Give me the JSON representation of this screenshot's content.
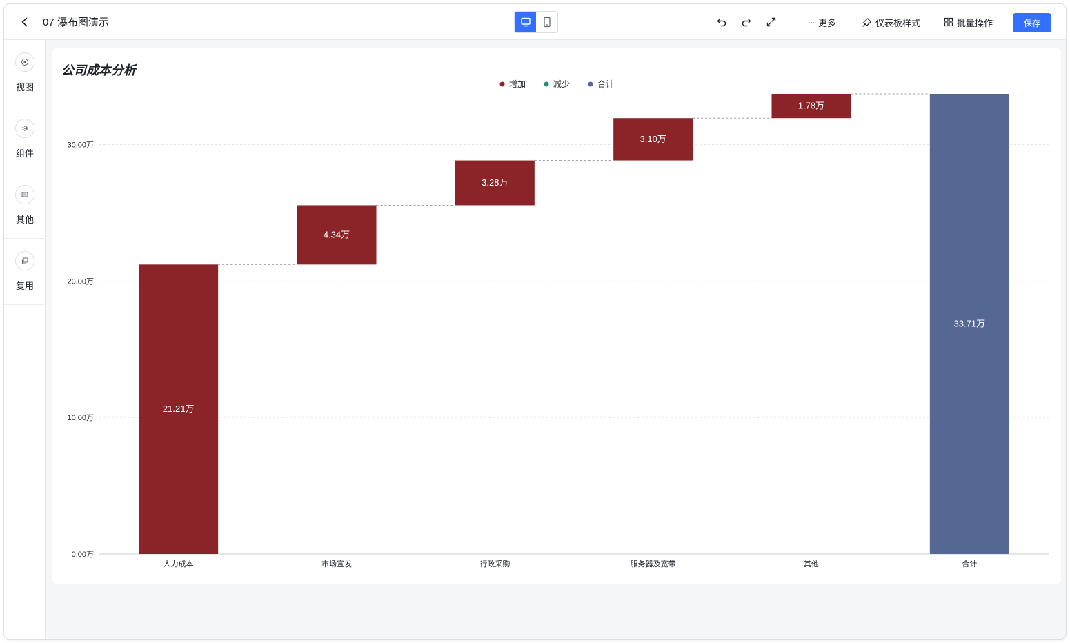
{
  "header": {
    "title": "07 瀑布图演示",
    "more_label": "更多",
    "style_label": "仪表板样式",
    "batch_label": "批量操作",
    "save_label": "保存"
  },
  "sidebar": {
    "items": [
      {
        "label": "视图",
        "icon": "view-icon"
      },
      {
        "label": "组件",
        "icon": "component-icon"
      },
      {
        "label": "其他",
        "icon": "other-icon"
      },
      {
        "label": "复用",
        "icon": "reuse-icon"
      }
    ]
  },
  "colors": {
    "accent": "#3370ff",
    "increase": "#8b2428",
    "decrease": "#2a8a7b",
    "total": "#556893"
  },
  "chart_data": {
    "type": "bar",
    "subtype": "waterfall",
    "title": "公司成本分析",
    "legend": [
      "增加",
      "减少",
      "合计"
    ],
    "legend_position": "top-center",
    "categories": [
      "人力成本",
      "市场宣发",
      "行政采购",
      "服务器及宽带",
      "其他",
      "合计"
    ],
    "values": [
      21.21,
      4.34,
      3.28,
      3.1,
      1.78,
      33.71
    ],
    "value_labels": [
      "21.21万",
      "4.34万",
      "3.28万",
      "3.10万",
      "1.78万",
      "33.71万"
    ],
    "kinds": [
      "increase",
      "increase",
      "increase",
      "increase",
      "increase",
      "total"
    ],
    "ylim": [
      0,
      33.71
    ],
    "yticks": [
      0,
      10,
      20,
      30
    ],
    "ytick_labels": [
      "0.00万",
      "10.00万",
      "20.00万",
      "30.00万"
    ],
    "grid": true
  }
}
